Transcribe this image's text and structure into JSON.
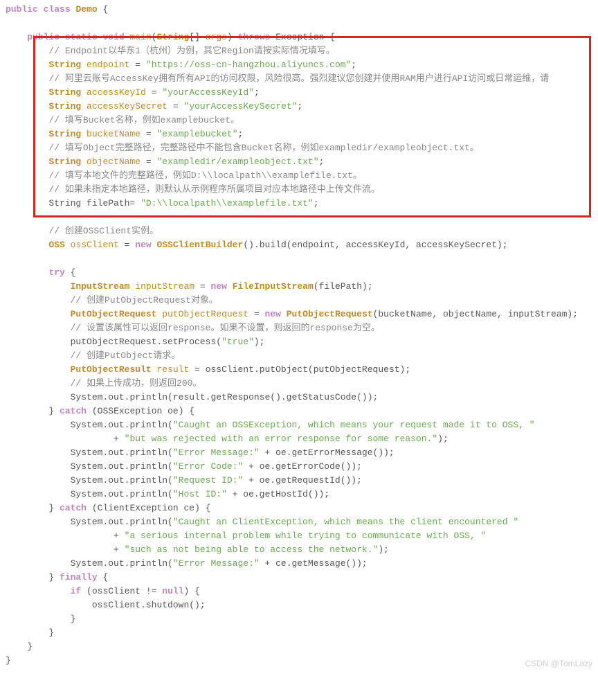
{
  "code": {
    "l1a": "public",
    "l1b": "class",
    "l1c": "Demo",
    "l1d": "{",
    "l3a": "public",
    "l3b": "static",
    "l3c": "void",
    "l3d": "main",
    "l3e": "(",
    "l3f": "String",
    "l3g": "[]",
    "l3h": "args",
    "l3i": ")",
    "l3j": "throws",
    "l3k": "Exception",
    "l3l": "{",
    "l4": "// Endpoint以华东1（杭州）为例，其它Region请按实际情况填写。",
    "l5a": "String",
    "l5b": "endpoint",
    "l5c": "=",
    "l5d": "\"https://oss-cn-hangzhou.aliyuncs.com\"",
    "l5e": ";",
    "l6": "// 阿里云账号AccessKey拥有所有API的访问权限，风险很高。强烈建议您创建并使用RAM用户进行API访问或日常运维，请",
    "l7a": "String",
    "l7b": "accessKeyId",
    "l7c": "=",
    "l7d": "\"yourAccessKeyId\"",
    "l7e": ";",
    "l8a": "String",
    "l8b": "accessKeySecret",
    "l8c": "=",
    "l8d": "\"yourAccessKeySecret\"",
    "l8e": ";",
    "l9": "// 填写Bucket名称，例如examplebucket。",
    "l10a": "String",
    "l10b": "bucketName",
    "l10c": "=",
    "l10d": "\"examplebucket\"",
    "l10e": ";",
    "l11": "// 填写Object完整路径，完整路径中不能包含Bucket名称，例如exampledir/exampleobject.txt。",
    "l12a": "String",
    "l12b": "objectName",
    "l12c": "=",
    "l12d": "\"exampledir/exampleobject.txt\"",
    "l12e": ";",
    "l13": "// 填写本地文件的完整路径，例如D:\\\\localpath\\\\examplefile.txt。",
    "l14": "// 如果未指定本地路径，则默认从示例程序所属项目对应本地路径中上传文件流。",
    "l15a": "String",
    "l15b": "filePath",
    "l15c": "=",
    "l15d": "\"D:\\\\localpath\\\\examplefile.txt\"",
    "l15e": ";",
    "l17": "// 创建OSSClient实例。",
    "l18a": "OSS",
    "l18b": "ossClient",
    "l18c": "=",
    "l18d": "new",
    "l18e": "OSSClientBuilder",
    "l18f": "().build(endpoint, accessKeyId, accessKeySecret);",
    "l20a": "try",
    "l20b": "{",
    "l21a": "InputStream",
    "l21b": "inputStream",
    "l21c": "=",
    "l21d": "new",
    "l21e": "FileInputStream",
    "l21f": "(filePath);",
    "l22": "// 创建PutObjectRequest对象。",
    "l23a": "PutObjectRequest",
    "l23b": "putObjectRequest",
    "l23c": "=",
    "l23d": "new",
    "l23e": "PutObjectRequest",
    "l23f": "(bucketName, objectName, inputStream);",
    "l24": "// 设置该属性可以返回response。如果不设置，则返回的response为空。",
    "l25a": "putObjectRequest.setProcess(",
    "l25b": "\"true\"",
    "l25c": ");",
    "l26": "// 创建PutObject请求。",
    "l27a": "PutObjectResult",
    "l27b": "result",
    "l27c": "= ossClient.putObject(putObjectRequest);",
    "l28": "// 如果上传成功，则返回200。",
    "l29": "System.out.println(result.getResponse().getStatusCode());",
    "l30a": "}",
    "l30b": "catch",
    "l30c": "(OSSException oe) {",
    "l31a": "System.out.println(",
    "l31b": "\"Caught an OSSException, which means your request made it to OSS, \"",
    "l32a": "+",
    "l32b": "\"but was rejected with an error response for some reason.\"",
    "l32c": ");",
    "l33a": "System.out.println(",
    "l33b": "\"Error Message:\"",
    "l33c": " + oe.getErrorMessage());",
    "l34a": "System.out.println(",
    "l34b": "\"Error Code:\"",
    "l34c": " + oe.getErrorCode());",
    "l35a": "System.out.println(",
    "l35b": "\"Request ID:\"",
    "l35c": " + oe.getRequestId());",
    "l36a": "System.out.println(",
    "l36b": "\"Host ID:\"",
    "l36c": " + oe.getHostId());",
    "l37a": "}",
    "l37b": "catch",
    "l37c": "(ClientException ce) {",
    "l38a": "System.out.println(",
    "l38b": "\"Caught an ClientException, which means the client encountered \"",
    "l39a": "+",
    "l39b": "\"a serious internal problem while trying to communicate with OSS, \"",
    "l40a": "+",
    "l40b": "\"such as not being able to access the network.\"",
    "l40c": ");",
    "l41a": "System.out.println(",
    "l41b": "\"Error Message:\"",
    "l41c": " + ce.getMessage());",
    "l42a": "}",
    "l42b": "finally",
    "l42c": "{",
    "l43a": "if",
    "l43b": "(ossClient !=",
    "l43c": "null",
    "l43d": ") {",
    "l44": "ossClient.shutdown();",
    "l45": "}",
    "l46": "}",
    "l47": "}",
    "l48": "}",
    "watermark": "CSDN @TomLazy"
  }
}
